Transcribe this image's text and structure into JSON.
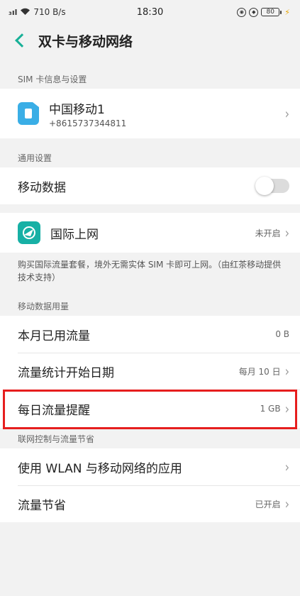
{
  "status_bar": {
    "signal": "₃ıl",
    "network_speed": "710 B/s",
    "time": "18:30",
    "battery": "80"
  },
  "header": {
    "title": "双卡与移动网络"
  },
  "sim_section": {
    "label": "SIM 卡信息与设置",
    "carrier": "中国移动1",
    "number": "+8615737344811"
  },
  "general_section": {
    "label": "通用设置",
    "mobile_data": "移动数据"
  },
  "intl": {
    "label": "国际上网",
    "status": "未开启",
    "note": "购买国际流量套餐，境外无需实体 SIM 卡即可上网。（由红茶移动提供技术支持）"
  },
  "usage_section": {
    "label": "移动数据用量",
    "rows": [
      {
        "label": "本月已用流量",
        "value": "0 B"
      },
      {
        "label": "流量统计开始日期",
        "value": "每月 10 日"
      },
      {
        "label": "每日流量提醒",
        "value": "1 GB"
      }
    ]
  },
  "network_section": {
    "label": "联网控制与流量节省",
    "rows": [
      {
        "label": "使用 WLAN 与移动网络的应用",
        "value": ""
      },
      {
        "label": "流量节省",
        "value": "已开启"
      }
    ]
  },
  "colors": {
    "accent": "#17b097",
    "highlight": "#e61e1e",
    "sim_icon": "#3aaee6"
  }
}
